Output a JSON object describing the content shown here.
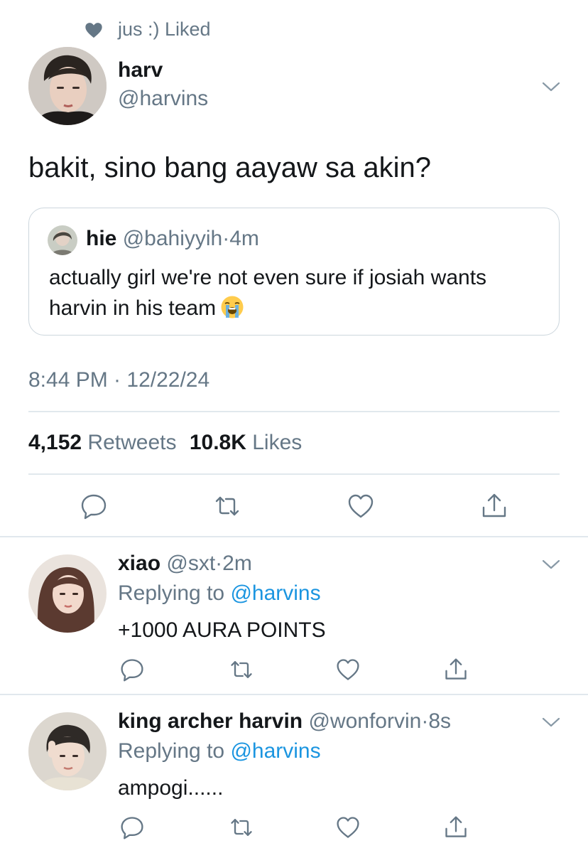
{
  "social_context": {
    "text": "jus :) Liked",
    "icon": "heart-icon"
  },
  "main_tweet": {
    "name": "harv",
    "handle": "@harvins",
    "text": "bakit, sino bang aayaw sa akin?",
    "quote": {
      "name": "hie",
      "handle": "@bahiyyih",
      "separator": "·",
      "time": "4m",
      "text": "actually girl we're not even sure if josiah wants harvin in his team",
      "emoji": "loudly-crying-face"
    },
    "timestamp": "8:44 PM · 12/22/24",
    "retweets_count": "4,152",
    "retweets_label": "Retweets",
    "likes_count": "10.8K",
    "likes_label": "Likes"
  },
  "replies": [
    {
      "name": "xiao",
      "handle": "@sxt",
      "separator": "·",
      "time": "2m",
      "replying_prefix": "Replying to",
      "replying_to": "@harvins",
      "text": "+1000 AURA POINTS"
    },
    {
      "name": "king archer harvin",
      "handle": "@wonforvin",
      "separator": "·",
      "time": "8s",
      "replying_prefix": "Replying to",
      "replying_to": "@harvins",
      "text": "ampogi......"
    }
  ],
  "colors": {
    "text": "#14171a",
    "muted": "#657786",
    "link": "#1b95e0",
    "divider": "#e1e8ed"
  },
  "icons": [
    "heart-icon",
    "chevron-down-icon",
    "reply-icon",
    "retweet-icon",
    "like-icon",
    "share-icon"
  ]
}
